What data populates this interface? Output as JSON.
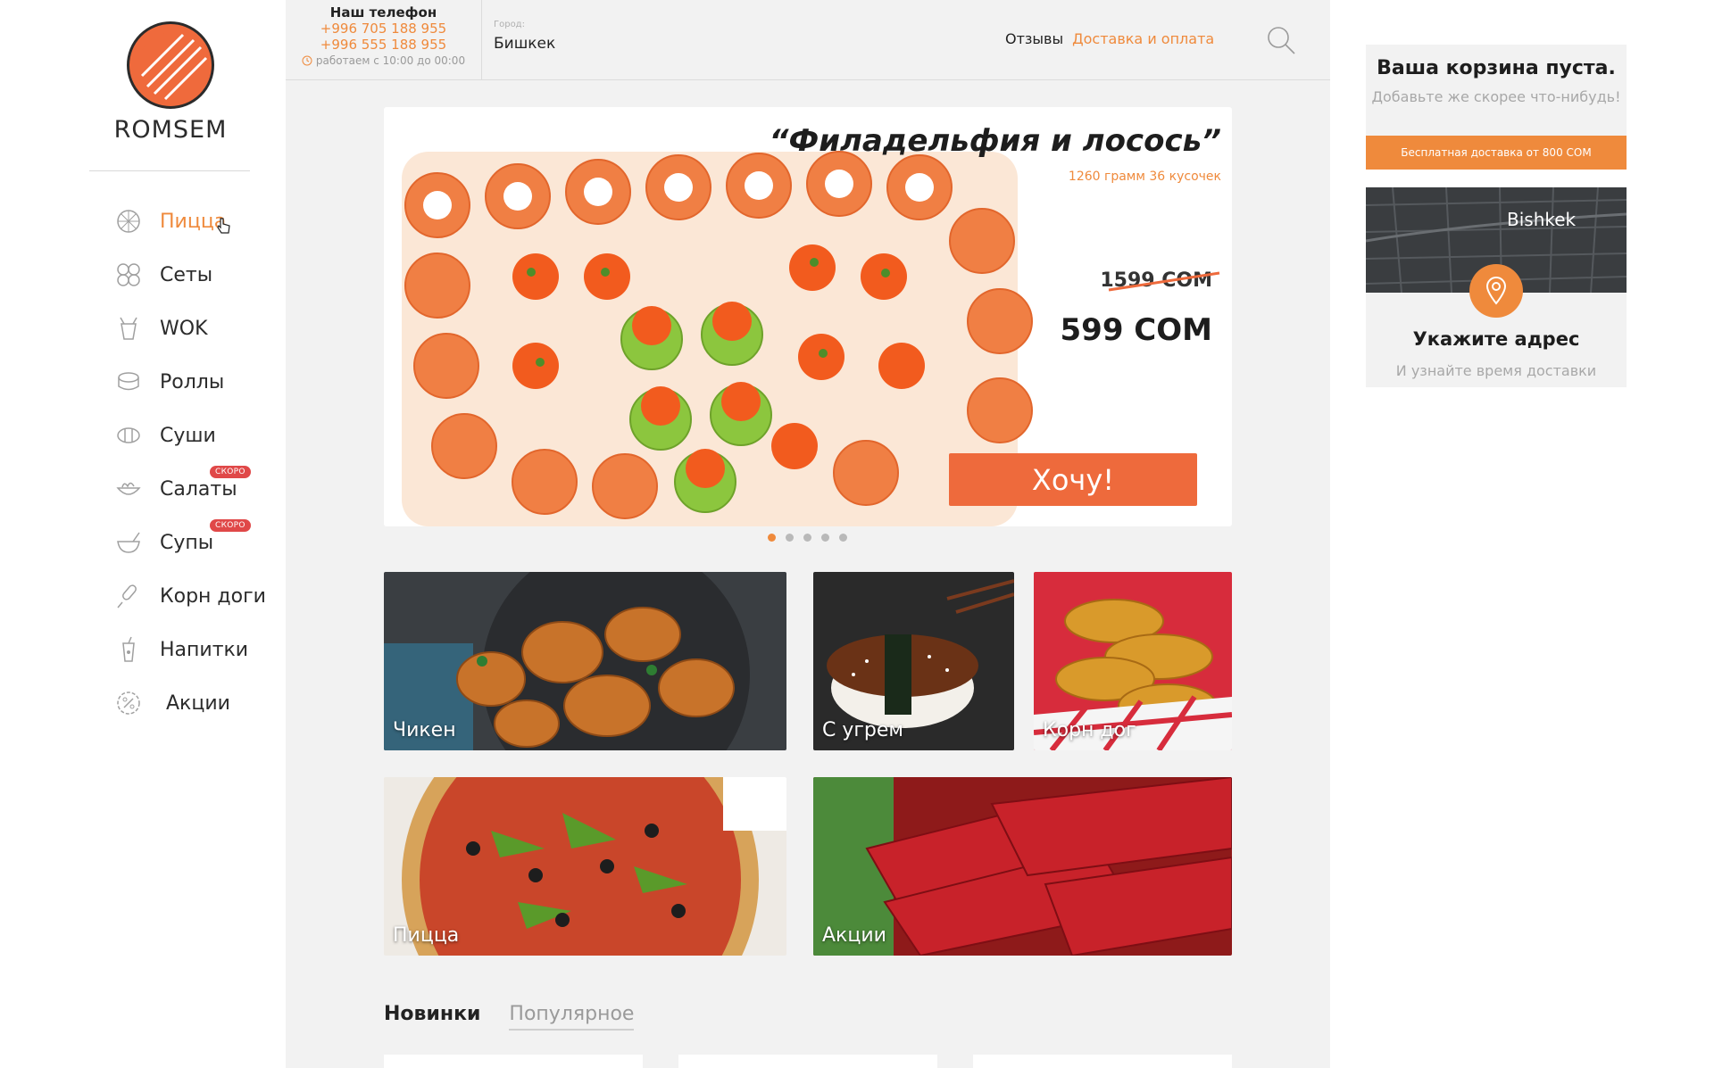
{
  "brand": {
    "name": "ROMSEM",
    "accent": "#ef8a3c",
    "button_color": "#ee6a3c"
  },
  "sidebar": {
    "items": [
      {
        "label": "Пицца",
        "icon": "pizza-icon",
        "active": true
      },
      {
        "label": "Сеты",
        "icon": "sets-icon"
      },
      {
        "label": "WOK",
        "icon": "wok-icon"
      },
      {
        "label": "Роллы",
        "icon": "rolls-icon"
      },
      {
        "label": "Суши",
        "icon": "sushi-icon"
      },
      {
        "label": "Салаты",
        "icon": "salad-icon",
        "badge": "СКОРО"
      },
      {
        "label": "Супы",
        "icon": "soup-icon",
        "badge": "СКОРО"
      },
      {
        "label": "Корн доги",
        "icon": "corndog-icon"
      },
      {
        "label": "Напитки",
        "icon": "drink-icon"
      },
      {
        "label": "Акции",
        "icon": "discount-icon"
      }
    ]
  },
  "header": {
    "phone_title": "Наш телефон",
    "phone_1": "+996 705 188 955",
    "phone_2": "+996 555 188 955",
    "hours": "работаем с 10:00 до 00:00",
    "city_label": "Город:",
    "city_value": "Бишкек",
    "nav_reviews": "Отзывы",
    "nav_delivery": "Доставка и оплата"
  },
  "hero": {
    "title": "“Филадельфия и лосось”",
    "subtitle": "1260 грамм 36 кусочек",
    "old_price": "1599 СОМ",
    "new_price": "599 СОМ",
    "button": "Хочу!",
    "slides": 5,
    "active_slide": 1
  },
  "tiles": {
    "chicken": "Чикен",
    "eel": "С угрем",
    "corndog": "Корн дог",
    "pizza": "Пицца",
    "promo": "Акции"
  },
  "tabs": {
    "new": "Новинки",
    "popular": "Популярное"
  },
  "cart": {
    "title": "Ваша корзина пуста.",
    "subtitle": "Добавьте же скорее что-нибудь!",
    "free_delivery": "Бесплатная доставка от 800 СОМ"
  },
  "map": {
    "city": "Bishkek",
    "title": "Укажите адрес",
    "subtitle": "И узнайте время доставки"
  }
}
